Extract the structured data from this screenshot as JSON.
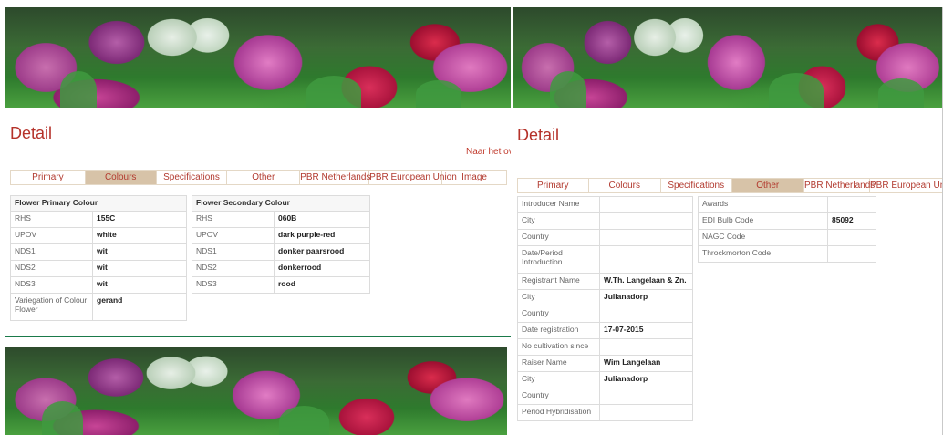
{
  "detail_title": "Detail",
  "back_link": "Naar het ove",
  "colours_page": {
    "tabs": [
      {
        "label": "Primary"
      },
      {
        "label": "Colours"
      },
      {
        "label": "Specifications"
      },
      {
        "label": "Other"
      },
      {
        "label": "PBR Netherlands"
      },
      {
        "label": "PBR European Union"
      },
      {
        "label": "Image"
      }
    ],
    "primary_colour": {
      "header": "Flower Primary Colour",
      "rows": [
        {
          "label": "RHS",
          "value": "155C"
        },
        {
          "label": "UPOV",
          "value": "white"
        },
        {
          "label": "NDS1",
          "value": "wit"
        },
        {
          "label": "NDS2",
          "value": "wit"
        },
        {
          "label": "NDS3",
          "value": "wit"
        },
        {
          "label": "Variegation of Colour Flower",
          "value": "gerand"
        }
      ]
    },
    "secondary_colour": {
      "header": "Flower Secondary Colour",
      "rows": [
        {
          "label": "RHS",
          "value": "060B"
        },
        {
          "label": "UPOV",
          "value": "dark purple-red"
        },
        {
          "label": "NDS1",
          "value": "donker paarsrood"
        },
        {
          "label": "NDS2",
          "value": "donkerrood"
        },
        {
          "label": "NDS3",
          "value": "rood"
        }
      ]
    }
  },
  "other_page": {
    "tabs": [
      {
        "label": "Primary"
      },
      {
        "label": "Colours"
      },
      {
        "label": "Specifications"
      },
      {
        "label": "Other"
      },
      {
        "label": "PBR Netherlands"
      },
      {
        "label": "PBR European Union"
      }
    ],
    "people": [
      {
        "label": "Introducer Name",
        "value": ""
      },
      {
        "label": "City",
        "value": ""
      },
      {
        "label": "Country",
        "value": ""
      },
      {
        "label": "Date/Period Introduction",
        "value": ""
      },
      {
        "label": "Registrant Name",
        "value": "W.Th. Langelaan & Zn."
      },
      {
        "label": "City",
        "value": "Julianadorp"
      },
      {
        "label": "Country",
        "value": ""
      },
      {
        "label": "Date registration",
        "value": "17-07-2015"
      },
      {
        "label": "No cultivation since",
        "value": ""
      },
      {
        "label": "Raiser Name",
        "value": "Wim Langelaan"
      },
      {
        "label": "City",
        "value": "Julianadorp"
      },
      {
        "label": "Country",
        "value": ""
      },
      {
        "label": "Period Hybridisation",
        "value": ""
      }
    ],
    "codes": [
      {
        "label": "Awards",
        "value": ""
      },
      {
        "label": "EDI Bulb Code",
        "value": "85092"
      },
      {
        "label": "NAGC Code",
        "value": ""
      },
      {
        "label": "Throckmorton Code",
        "value": ""
      }
    ]
  },
  "colors": {
    "title_red": "#b5322a",
    "active_tab": "#d7c3a8",
    "tab_border": "#e4d8c6",
    "panel_divider": "#1a7a4a"
  }
}
